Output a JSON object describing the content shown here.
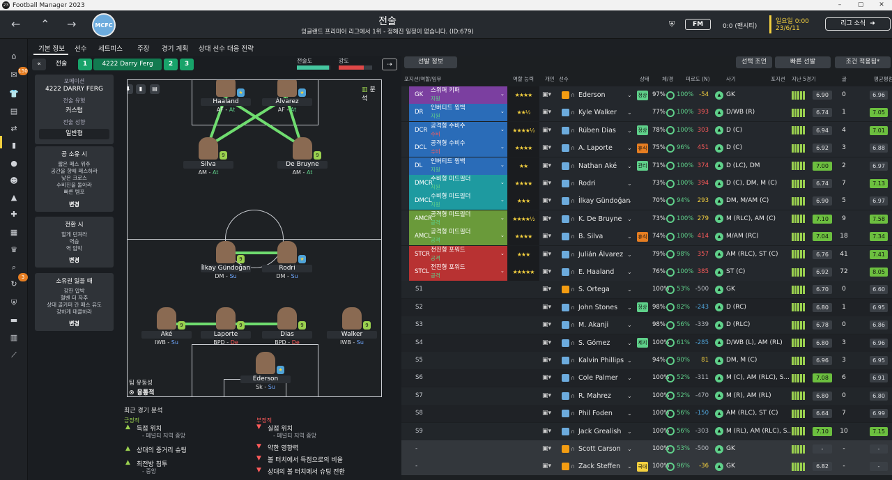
{
  "window": {
    "title": "Football Manager 2023",
    "logo": "23"
  },
  "header": {
    "title": "전술",
    "subtitle": "잉글랜드 프리미어 리그에서 1위 - 정해진 일정이 없습니다. (ID:679)",
    "club_crest": "MCFC",
    "fm_label": "FM",
    "score": "0:0 (맨시티)",
    "day": "일요일 0:00",
    "date": "23/6/11",
    "league_button": "리그 소식"
  },
  "nav_badges": {
    "inbox": "150",
    "dev": "3"
  },
  "tabs": [
    "기본 정보",
    "선수",
    "세트피스",
    "주장",
    "경기 계획",
    "상대 선수 대응 전략"
  ],
  "tactic": {
    "label": "전술",
    "formation_name": "4222 Darry Ferg",
    "slot1": "1",
    "slot2": "2",
    "slot3": "3",
    "fitness_label": "전술도",
    "intensity_label": "강도",
    "fitness_pct": 0.95,
    "intensity_pct": 0.75
  },
  "left_panel": {
    "formation_label": "포메이션",
    "formation": "4222 DARRY FERG",
    "style_label": "전술 유형",
    "style": "커스텀",
    "mentality_label": "전술 성향",
    "mentality": "일반형",
    "in_possession_title": "공 소유 시",
    "in_possession": [
      "짧은 패스 위주",
      "공간을 향해 패스하라",
      "낮은 크로스",
      "수비진을 돌아라",
      "빠른 템포"
    ],
    "transition_title": "전환 시",
    "transition": [
      "헐게 던져라",
      "역습",
      "역 압박"
    ],
    "out_possession_title": "소유권 잃을 때",
    "out_possession": [
      "강한 압박",
      "혈벤 더 자주",
      "상대 골키퍼 간 패스 유도",
      "강하게 태클하라"
    ],
    "change": "변경"
  },
  "pitch": {
    "analysis_label": "분석",
    "fluidity_label": "팀 유동성",
    "fluidity": "융통적",
    "players": [
      {
        "name": "Haaland",
        "pos": "AF",
        "duty": "At",
        "cls": "at",
        "badge": "star"
      },
      {
        "name": "Álvarez",
        "pos": "AF",
        "duty": "At",
        "cls": "at",
        "badge": "star"
      },
      {
        "name": "Silva",
        "pos": "AM",
        "duty": "At",
        "cls": "at",
        "badge": "9"
      },
      {
        "name": "De Bruyne",
        "pos": "AM",
        "duty": "At",
        "cls": "at",
        "badge": "9"
      },
      {
        "name": "İlkay Gündoğan",
        "pos": "DM",
        "duty": "Su",
        "cls": "su",
        "badge": "9"
      },
      {
        "name": "Rodri",
        "pos": "DM",
        "duty": "Su",
        "cls": "su",
        "badge": "star"
      },
      {
        "name": "Aké",
        "pos": "IWB",
        "duty": "Su",
        "cls": "su",
        "badge": "9"
      },
      {
        "name": "Laporte",
        "pos": "BPD",
        "duty": "De",
        "cls": "de",
        "badge": "9"
      },
      {
        "name": "Dias",
        "pos": "BPD",
        "duty": "De",
        "cls": "de",
        "badge": "9"
      },
      {
        "name": "Walker",
        "pos": "IWB",
        "duty": "Su",
        "cls": "su",
        "badge": "9"
      },
      {
        "name": "Ederson",
        "pos": "Sk",
        "duty": "Su",
        "cls": "su",
        "badge": "star"
      }
    ]
  },
  "analysis": {
    "title": "최근 경기 분석",
    "pos_title": "긍정적",
    "neg_title": "부정적",
    "positives": [
      {
        "t": "득점 위치",
        "s": "- 페널티 지역 중앙"
      },
      {
        "t": "상대의 중거리 슈팅",
        "s": ""
      },
      {
        "t": "최전방 침투",
        "s": "- 중앙"
      }
    ],
    "negatives": [
      {
        "t": "실점 위치",
        "s": "- 페널티 지역 중앙"
      },
      {
        "t": "약한 영향력",
        "s": ""
      },
      {
        "t": "볼 터치에서 득점으로의 비율",
        "s": ""
      },
      {
        "t": "상대의 볼 터치에서 슈팅 전환",
        "s": ""
      }
    ]
  },
  "squad": {
    "info_button": "선발 정보",
    "suggest": "선택 조언",
    "quick_pick": "빠른 선발",
    "conditions": "조건 적용됨*",
    "columns": [
      "포지션/역할/임무",
      "역할 능력",
      "개인",
      "선수",
      "상태",
      "체/경",
      "피로도 (N)",
      "사기",
      "포지션",
      "지난 5경기",
      "골",
      "평균평점"
    ],
    "rows": [
      {
        "code": "GK",
        "r1": "스위퍼 키퍼",
        "r2": "지원",
        "r2c": "#5fd08a",
        "color": "#7b3fa0",
        "stars": "★★★★",
        "shirt": "#f39c12",
        "name": "Ederson",
        "st": "정상",
        "stc": "#5fd08a",
        "cond": "97%",
        "sh": "100%",
        "fat": "-54",
        "fc": "#f4d03f",
        "pos": "GK",
        "rt": "6.90",
        "goals": "0",
        "avg": "6.96",
        "hi": false
      },
      {
        "code": "DR",
        "r1": "인버티드 윙백",
        "r2": "지원",
        "r2c": "#5fd08a",
        "color": "#2a6cb8",
        "stars": "★★½",
        "shirt": "#6cabdd",
        "name": "Kyle Walker",
        "st": "",
        "stc": "",
        "cond": "77%",
        "sh": "100%",
        "fat": "393",
        "fc": "#ff5b5b",
        "pos": "D/WB (R)",
        "rt": "6.74",
        "goals": "1",
        "avg": "7.05",
        "hi": true
      },
      {
        "code": "DCR",
        "r1": "공격형 수비수",
        "r2": "수비",
        "r2c": "#ff5b5b",
        "color": "#2a6cb8",
        "stars": "★★★★½",
        "shirt": "#6cabdd",
        "name": "Rúben Dias",
        "st": "정상",
        "stc": "#5fd08a",
        "cond": "78%",
        "sh": "100%",
        "fat": "303",
        "fc": "#ff5b5b",
        "pos": "D (C)",
        "rt": "6.94",
        "goals": "4",
        "avg": "7.01",
        "hi": true
      },
      {
        "code": "DCL",
        "r1": "공격형 수비수",
        "r2": "수비",
        "r2c": "#ff5b5b",
        "color": "#2a6cb8",
        "stars": "★★★★",
        "shirt": "#6cabdd",
        "name": "A. Laporte",
        "st": "휴식",
        "stc": "#e67e22",
        "cond": "75%",
        "sh": "96%",
        "fat": "451",
        "fc": "#ff5b5b",
        "pos": "D (C)",
        "rt": "6.92",
        "goals": "3",
        "avg": "6.88",
        "hi": false
      },
      {
        "code": "DL",
        "r1": "인버티드 윙백",
        "r2": "지원",
        "r2c": "#5fd08a",
        "color": "#2a6cb8",
        "stars": "★★",
        "shirt": "#6cabdd",
        "name": "Nathan Aké",
        "st": "관리",
        "stc": "#5fd08a",
        "cond": "71%",
        "sh": "100%",
        "fat": "374",
        "fc": "#ff5b5b",
        "pos": "D (LC), DM",
        "rt": "7.00",
        "goals": "2",
        "avg": "6.97",
        "hi": false
      },
      {
        "code": "DMCR",
        "r1": "수비형 미드필더",
        "r2": "지원",
        "r2c": "#5fd08a",
        "color": "#1e9aa0",
        "stars": "★★★★",
        "shirt": "#6cabdd",
        "name": "Rodri",
        "st": "",
        "stc": "",
        "cond": "73%",
        "sh": "100%",
        "fat": "394",
        "fc": "#ff5b5b",
        "pos": "D (C), DM, M (C)",
        "rt": "6.74",
        "goals": "7",
        "avg": "7.13",
        "hi": true
      },
      {
        "code": "DMCL",
        "r1": "수비형 미드필더",
        "r2": "지원",
        "r2c": "#5fd08a",
        "color": "#1e9aa0",
        "stars": "★★★",
        "shirt": "#6cabdd",
        "name": "İlkay Gündoğan",
        "st": "",
        "stc": "",
        "cond": "70%",
        "sh": "94%",
        "fat": "293",
        "fc": "#f4d03f",
        "pos": "DM, M/AM (C)",
        "rt": "6.90",
        "goals": "5",
        "avg": "6.97",
        "hi": false
      },
      {
        "code": "AMCR",
        "r1": "공격형 미드필더",
        "r2": "공격",
        "r2c": "#5fd08a",
        "color": "#6a9a3a",
        "stars": "★★★★½",
        "shirt": "#6cabdd",
        "name": "K. De Bruyne",
        "st": "",
        "stc": "",
        "cond": "73%",
        "sh": "100%",
        "fat": "279",
        "fc": "#f4d03f",
        "pos": "M (RLC), AM (C)",
        "rt": "7.10",
        "goals": "9",
        "avg": "7.58",
        "hi": true
      },
      {
        "code": "AMCL",
        "r1": "공격형 미드필더",
        "r2": "공격",
        "r2c": "#5fd08a",
        "color": "#6a9a3a",
        "stars": "★★★★",
        "shirt": "#6cabdd",
        "name": "B. Silva",
        "st": "휴식",
        "stc": "#e67e22",
        "cond": "74%",
        "sh": "100%",
        "fat": "414",
        "fc": "#ff5b5b",
        "pos": "M/AM (RC)",
        "rt": "7.04",
        "goals": "18",
        "avg": "7.34",
        "hi": true
      },
      {
        "code": "STCR",
        "r1": "전진형 포워드",
        "r2": "공격",
        "r2c": "#5fd08a",
        "color": "#b83232",
        "stars": "★★★",
        "shirt": "#6cabdd",
        "name": "Julián Álvarez",
        "st": "",
        "stc": "",
        "cond": "79%",
        "sh": "98%",
        "fat": "357",
        "fc": "#ff5b5b",
        "pos": "AM (RLC), ST (C)",
        "rt": "6.76",
        "goals": "41",
        "avg": "7.41",
        "hi": true
      },
      {
        "code": "STCL",
        "r1": "전진형 포워드",
        "r2": "공격",
        "r2c": "#5fd08a",
        "color": "#b83232",
        "stars": "★★★★★",
        "shirt": "#6cabdd",
        "name": "E. Haaland",
        "st": "",
        "stc": "",
        "cond": "76%",
        "sh": "100%",
        "fat": "385",
        "fc": "#ff5b5b",
        "pos": "ST (C)",
        "rt": "6.92",
        "goals": "72",
        "avg": "8.05",
        "hi": true
      },
      {
        "code": "S1",
        "r1": "",
        "r2": "",
        "r2c": "",
        "color": "",
        "stars": "",
        "shirt": "#f39c12",
        "name": "S. Ortega",
        "st": "",
        "stc": "",
        "cond": "100%",
        "sh": "53%",
        "fat": "-500",
        "fc": "#b6bac0",
        "pos": "GK",
        "rt": "6.70",
        "goals": "0",
        "avg": "6.60",
        "hi": false
      },
      {
        "code": "S2",
        "r1": "",
        "r2": "",
        "r2c": "",
        "color": "",
        "stars": "",
        "shirt": "#6cabdd",
        "name": "John Stones",
        "st": "정상",
        "stc": "#5fd08a",
        "cond": "98%",
        "sh": "82%",
        "fat": "-243",
        "fc": "#4fa3d8",
        "pos": "D (RC)",
        "rt": "6.80",
        "goals": "1",
        "avg": "6.95",
        "hi": false
      },
      {
        "code": "S3",
        "r1": "",
        "r2": "",
        "r2c": "",
        "color": "",
        "stars": "",
        "shirt": "#6cabdd",
        "name": "M. Akanji",
        "st": "",
        "stc": "",
        "cond": "98%",
        "sh": "56%",
        "fat": "-339",
        "fc": "#b6bac0",
        "pos": "D (RLC)",
        "rt": "6.78",
        "goals": "0",
        "avg": "6.86",
        "hi": false
      },
      {
        "code": "S4",
        "r1": "",
        "r2": "",
        "r2c": "",
        "color": "",
        "stars": "",
        "shirt": "#6cabdd",
        "name": "S. Gómez",
        "st": "제지",
        "stc": "#5fd08a",
        "cond": "100%",
        "sh": "61%",
        "fat": "-285",
        "fc": "#4fa3d8",
        "pos": "D/WB (L), AM (RL)",
        "rt": "6.80",
        "goals": "3",
        "avg": "6.96",
        "hi": false
      },
      {
        "code": "S5",
        "r1": "",
        "r2": "",
        "r2c": "",
        "color": "",
        "stars": "",
        "shirt": "#6cabdd",
        "name": "Kalvin Phillips",
        "st": "",
        "stc": "",
        "cond": "94%",
        "sh": "90%",
        "fat": "81",
        "fc": "#f4d03f",
        "pos": "DM, M (C)",
        "rt": "6.96",
        "goals": "3",
        "avg": "6.95",
        "hi": false
      },
      {
        "code": "S6",
        "r1": "",
        "r2": "",
        "r2c": "",
        "color": "",
        "stars": "",
        "shirt": "#6cabdd",
        "name": "Cole Palmer",
        "st": "",
        "stc": "",
        "cond": "100%",
        "sh": "52%",
        "fat": "-311",
        "fc": "#b6bac0",
        "pos": "M (C), AM (RLC), S...",
        "rt": "7.08",
        "goals": "6",
        "avg": "6.91",
        "hi": false
      },
      {
        "code": "S7",
        "r1": "",
        "r2": "",
        "r2c": "",
        "color": "",
        "stars": "",
        "shirt": "#6cabdd",
        "name": "R. Mahrez",
        "st": "",
        "stc": "",
        "cond": "100%",
        "sh": "52%",
        "fat": "-470",
        "fc": "#b6bac0",
        "pos": "M (R), AM (RL)",
        "rt": "6.80",
        "goals": "0",
        "avg": "6.80",
        "hi": false
      },
      {
        "code": "S8",
        "r1": "",
        "r2": "",
        "r2c": "",
        "color": "",
        "stars": "",
        "shirt": "#6cabdd",
        "name": "Phil Foden",
        "st": "",
        "stc": "",
        "cond": "100%",
        "sh": "56%",
        "fat": "-150",
        "fc": "#4fa3d8",
        "pos": "AM (RLC), ST (C)",
        "rt": "6.64",
        "goals": "7",
        "avg": "6.99",
        "hi": false
      },
      {
        "code": "S9",
        "r1": "",
        "r2": "",
        "r2c": "",
        "color": "",
        "stars": "",
        "shirt": "#6cabdd",
        "name": "Jack Grealish",
        "st": "",
        "stc": "",
        "cond": "100%",
        "sh": "56%",
        "fat": "-303",
        "fc": "#b6bac0",
        "pos": "M (RL), AM (RLC), S...",
        "rt": "7.10",
        "goals": "10",
        "avg": "7.15",
        "hi": true
      },
      {
        "code": "-",
        "r1": "",
        "r2": "",
        "r2c": "",
        "color": "",
        "stars": "",
        "shirt": "#f39c12",
        "name": "Scott Carson",
        "st": "",
        "stc": "",
        "cond": "100%",
        "sh": "53%",
        "fat": "-500",
        "fc": "#b6bac0",
        "pos": "GK",
        "rt": "-",
        "goals": "-",
        "avg": "-",
        "hi": false
      },
      {
        "code": "-",
        "r1": "",
        "r2": "",
        "r2c": "",
        "color": "",
        "stars": "",
        "shirt": "#f39c12",
        "name": "Zack Steffen",
        "st": "국대",
        "stc": "#f4d03f",
        "cond": "100%",
        "sh": "96%",
        "fat": "-36",
        "fc": "#f4d03f",
        "pos": "GK",
        "rt": "6.82",
        "goals": "-",
        "avg": "-",
        "hi": false
      }
    ]
  }
}
